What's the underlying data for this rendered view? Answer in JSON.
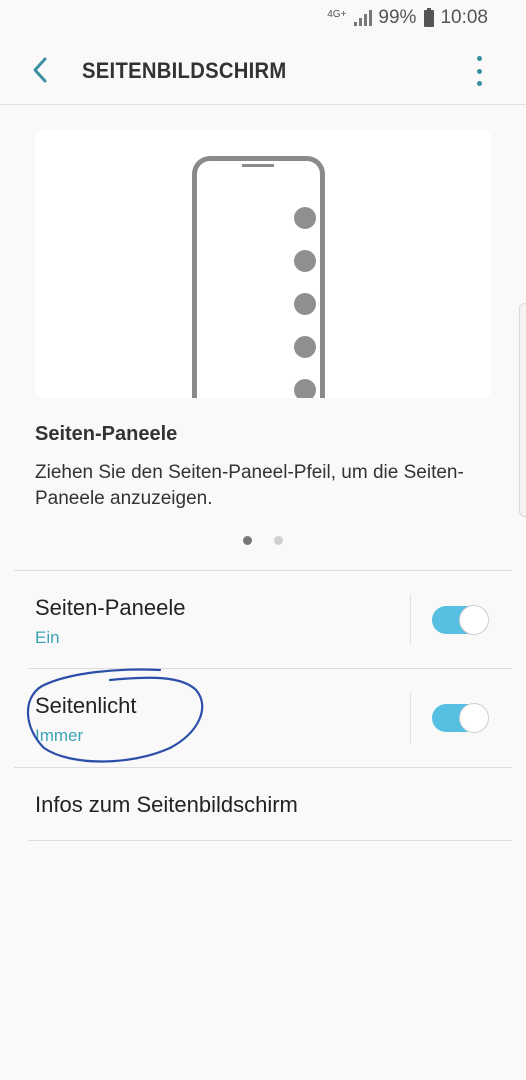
{
  "status_bar": {
    "network": "4G+",
    "battery": "99%",
    "time": "10:08"
  },
  "app_bar": {
    "title": "SEITENBILDSCHIRM"
  },
  "illustration_card": {
    "heading": "Seiten-Paneele",
    "description": "Ziehen Sie den Seiten-Paneel-Pfeil, um die Seiten-Paneele anzuzeigen.",
    "page_count": 2,
    "active_page": 1
  },
  "settings": [
    {
      "title": "Seiten-Paneele",
      "subtitle": "Ein",
      "toggle_on": true
    },
    {
      "title": "Seitenlicht",
      "subtitle": "Immer",
      "toggle_on": true
    },
    {
      "title": "Infos zum Seitenbildschirm"
    }
  ],
  "colors": {
    "accent": "#3a8fa2",
    "subtitle": "#3ea3b7",
    "toggle_on": "#56bfe2",
    "annotation": "#2b4ea8"
  }
}
